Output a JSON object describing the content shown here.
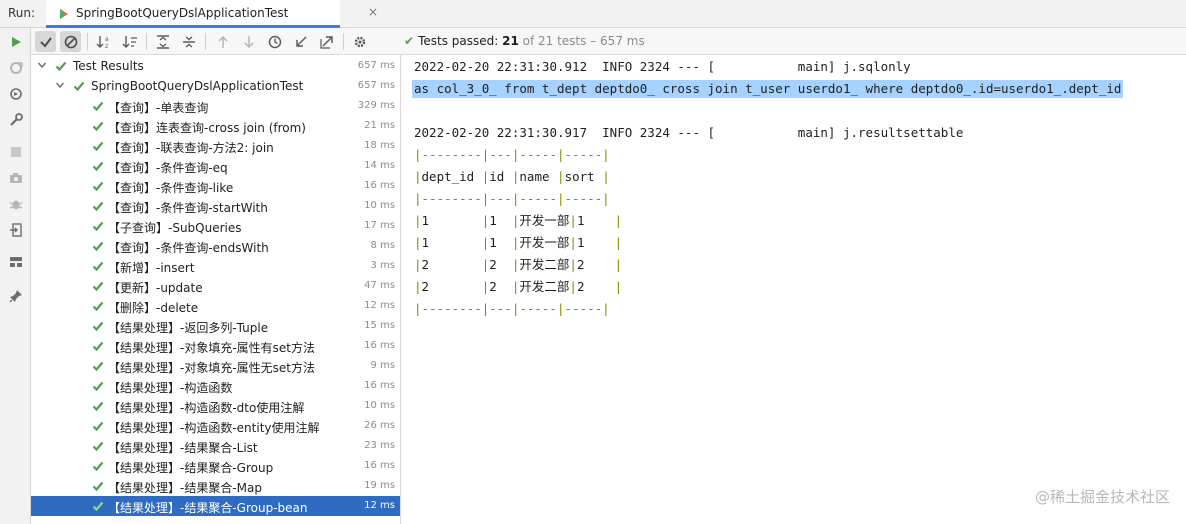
{
  "run_bar": {
    "label": "Run:",
    "tab_title": "SpringBootQueryDslApplicationTest",
    "close_glyph": "×"
  },
  "vertical_toolbar": [
    "rerun-icon",
    "rerun-failed-icon",
    "toggle-auto-test-icon",
    "settings-wrench-icon",
    "stop-icon",
    "camera-icon",
    "debug-icon",
    "exit-icon",
    "layout-icon",
    "pin-icon"
  ],
  "toolbar": {
    "buttons": [
      "show-passed-icon",
      "show-ignored-icon",
      "sort-alpha-icon",
      "sort-duration-icon",
      "expand-all-icon",
      "collapse-all-icon",
      "previous-failed-icon",
      "next-failed-icon",
      "history-icon",
      "import-tests-icon",
      "export-tests-icon",
      "settings-gear-icon"
    ],
    "status_prefix": "Tests passed: ",
    "passed_count": "21",
    "of_text": "of 21 tests",
    "dash": "–",
    "duration": "657 ms"
  },
  "tree": {
    "root": {
      "name": "Test Results",
      "time": "657 ms"
    },
    "suite": {
      "name": "SpringBootQueryDslApplicationTest",
      "time": "657 ms"
    },
    "tests": [
      {
        "name": "【查询】-单表查询",
        "time": "329 ms"
      },
      {
        "name": "【查询】连表查询-cross join (from)",
        "time": "21 ms"
      },
      {
        "name": "【查询】-联表查询-方法2: join",
        "time": "18 ms"
      },
      {
        "name": "【查询】-条件查询-eq",
        "time": "14 ms"
      },
      {
        "name": "【查询】-条件查询-like",
        "time": "16 ms"
      },
      {
        "name": "【查询】-条件查询-startWith",
        "time": "10 ms"
      },
      {
        "name": "【子查询】-SubQueries",
        "time": "17 ms"
      },
      {
        "name": "【查询】-条件查询-endsWith",
        "time": "8 ms"
      },
      {
        "name": "【新增】-insert",
        "time": "3 ms"
      },
      {
        "name": "【更新】-update",
        "time": "47 ms"
      },
      {
        "name": "【删除】-delete",
        "time": "12 ms"
      },
      {
        "name": "【结果处理】-返回多列-Tuple",
        "time": "15 ms"
      },
      {
        "name": "【结果处理】-对象填充-属性有set方法",
        "time": "16 ms"
      },
      {
        "name": "【结果处理】-对象填充-属性无set方法",
        "time": "9 ms"
      },
      {
        "name": "【结果处理】-构造函数",
        "time": "16 ms"
      },
      {
        "name": "【结果处理】-构造函数-dto使用注解",
        "time": "10 ms"
      },
      {
        "name": "【结果处理】-构造函数-entity使用注解",
        "time": "26 ms"
      },
      {
        "name": "【结果处理】-结果聚合-List",
        "time": "23 ms"
      },
      {
        "name": "【结果处理】-结果聚合-Group",
        "time": "16 ms"
      },
      {
        "name": "【结果处理】-结果聚合-Map",
        "time": "19 ms"
      },
      {
        "name": "【结果处理】-结果聚合-Group-bean",
        "time": "12 ms",
        "selected": true
      }
    ]
  },
  "console": {
    "log1": "2022-02-20 22:31:30.912  INFO 2324 --- [           main] j.sqlonly",
    "sql": "as col_3_0_ from t_dept deptdo0_ cross join t_user userdo1_ where deptdo0_.id=userdo1_.dept_id",
    "log2": "2022-02-20 22:31:30.917  INFO 2324 --- [           main] j.resultsettable",
    "table": {
      "border": "|--------|---|-----|-----|",
      "header": "|dept_id |id |name |sort |",
      "rows": [
        [
          "1",
          "1",
          "开发一部",
          "1"
        ],
        [
          "1",
          "1",
          "开发一部",
          "1"
        ],
        [
          "2",
          "2",
          "开发二部",
          "2"
        ],
        [
          "2",
          "2",
          "开发二部",
          "2"
        ]
      ]
    }
  },
  "watermark": "@稀土掘金技术社区",
  "colors": {
    "accent": "#3d7dd8",
    "selection": "#2e6bc1",
    "pass": "#4e9f53",
    "highlight": "#a6d2ff",
    "table_border": "#8a8a00"
  }
}
